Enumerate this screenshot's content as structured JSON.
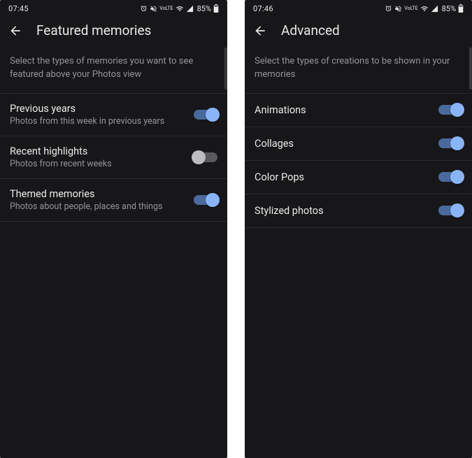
{
  "screens": [
    {
      "status": {
        "time": "07:45",
        "battery": "85%"
      },
      "header": {
        "title": "Featured memories"
      },
      "description": "Select the types of memories you want to see featured above your Photos view",
      "items": [
        {
          "title": "Previous years",
          "subtitle": "Photos from this week in previous years",
          "enabled": true
        },
        {
          "title": "Recent highlights",
          "subtitle": "Photos from recent weeks",
          "enabled": false
        },
        {
          "title": "Themed memories",
          "subtitle": "Photos about people, places and things",
          "enabled": true
        }
      ]
    },
    {
      "status": {
        "time": "07:46",
        "battery": "85%"
      },
      "header": {
        "title": "Advanced"
      },
      "description": "Select the types of creations to be shown in your memories",
      "items": [
        {
          "title": "Animations",
          "enabled": true
        },
        {
          "title": "Collages",
          "enabled": true
        },
        {
          "title": "Color Pops",
          "enabled": true
        },
        {
          "title": "Stylized photos",
          "enabled": true
        }
      ]
    }
  ]
}
